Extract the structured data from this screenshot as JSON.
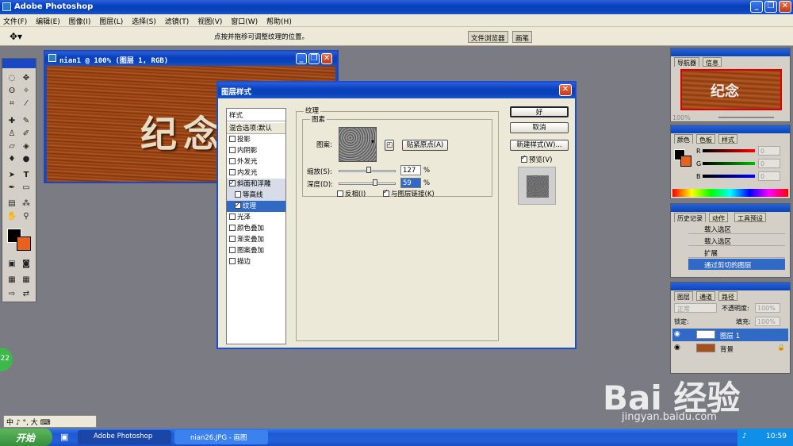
{
  "app": {
    "title": "Adobe Photoshop"
  },
  "menu": [
    "文件(F)",
    "编辑(E)",
    "图像(I)",
    "图层(L)",
    "选择(S)",
    "滤镜(T)",
    "视图(V)",
    "窗口(W)",
    "帮助(H)"
  ],
  "options_bar": {
    "hint": "点按并拖移可调整纹理的位置。",
    "tab_file_browser": "文件浏览器",
    "tab_brushes": "画笔"
  },
  "document": {
    "title": "nian1 @ 100% (图层 1, RGB)",
    "canvas_text": "纪念"
  },
  "dialog": {
    "title": "图层样式",
    "styles_header": "样式",
    "blend_options": "混合选项:默认",
    "styles": [
      {
        "label": "投影",
        "checked": false
      },
      {
        "label": "内阴影",
        "checked": false
      },
      {
        "label": "外发光",
        "checked": false
      },
      {
        "label": "内发光",
        "checked": false
      },
      {
        "label": "斜面和浮雕",
        "checked": true
      },
      {
        "label": "等高线",
        "checked": false
      },
      {
        "label": "纹理",
        "checked": true
      },
      {
        "label": "光泽",
        "checked": false
      },
      {
        "label": "颜色叠加",
        "checked": false
      },
      {
        "label": "渐变叠加",
        "checked": false
      },
      {
        "label": "图案叠加",
        "checked": false
      },
      {
        "label": "描边",
        "checked": false
      }
    ],
    "section_title": "纹理",
    "group_title": "图素",
    "pattern_label": "图案:",
    "snap_origin": "贴紧原点(A)",
    "scale_label": "缩放(S):",
    "scale_value": "127",
    "scale_unit": "%",
    "depth_label": "深度(D):",
    "depth_value": "59",
    "depth_unit": "%",
    "invert_label": "反相(I)",
    "link_label": "与图层链接(K)",
    "ok": "好",
    "cancel": "取消",
    "new_style": "新建样式(W)...",
    "preview_label": "预览(V)"
  },
  "panels": {
    "navigator_tab": "导航器",
    "info_tab": "信息",
    "nav_text": "纪念",
    "nav_zoom": "100%",
    "color_tab": "颜色",
    "swatches_tab": "色板",
    "styles_tab": "样式",
    "color_r": "R",
    "color_g": "G",
    "color_b": "B",
    "color_r_value": "0",
    "color_g_value": "0",
    "color_b_value": "0",
    "history_tab": "历史记录",
    "actions_tab": "动作",
    "presets_tab": "工具预设",
    "history": [
      "载入选区",
      "载入选区",
      "扩展",
      "通过剪切的图层"
    ],
    "layers_tab": "图层",
    "channels_tab": "通道",
    "paths_tab": "路径",
    "blend_mode": "正常",
    "opacity_label": "不透明度:",
    "opacity_value": "100%",
    "lock_label": "锁定:",
    "fill_label": "填充:",
    "fill_value": "100%",
    "layers": [
      "图层 1",
      "背景"
    ]
  },
  "ime": {
    "text": "中 ♪ °, 大"
  },
  "taskbar": {
    "start": "开始",
    "tasks": [
      "Adobe Photoshop",
      "nian26.JPG - 画图"
    ],
    "clock": "10:59"
  },
  "watermark": {
    "brand": "Bai 经验",
    "url": "jingyan.baidu.com"
  },
  "badge": {
    "text": "22"
  },
  "colors": {
    "accent": "#316ac5",
    "wood": "#a8501c"
  }
}
